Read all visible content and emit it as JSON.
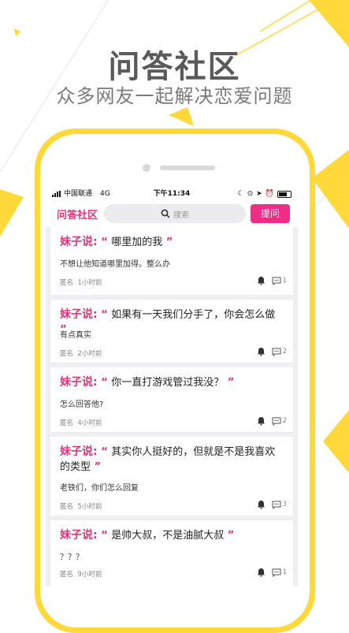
{
  "colors": {
    "accent": "#e6337a",
    "button": "#ee2e86",
    "frame": "#ffd93a"
  },
  "promo": {
    "title": "问答社区",
    "subtitle": "众多网友一起解决恋爱问题"
  },
  "status": {
    "carrier": "中国联通",
    "network": "4G",
    "time": "下午11:34"
  },
  "nav": {
    "title": "问答社区",
    "search_placeholder": "搜索",
    "ask_label": "提问"
  },
  "feed": [
    {
      "prefix": "妹子说:",
      "question": "哪里加的我",
      "answer": "不想让他知道哪里加得。整么办",
      "user": "匿名",
      "time": "1小时前",
      "comments": "1"
    },
    {
      "prefix": "妹子说:",
      "question": "如果有一天我们分手了，你会怎么做",
      "answer": "有点真实",
      "user": "匿名",
      "time": "2小时前",
      "comments": "2"
    },
    {
      "prefix": "妹子说:",
      "question": "你一直打游戏管过我没？",
      "answer": "怎么回答他?",
      "user": "匿名",
      "time": "4小时前",
      "comments": "2"
    },
    {
      "prefix": "妹子说:",
      "question": "其实你人挺好的，但就是不是我喜欢的类型",
      "answer": "老铁们，你们怎么回复",
      "user": "匿名",
      "time": "5小时前",
      "comments": "3"
    },
    {
      "prefix": "妹子说:",
      "question": "是帅大叔，不是油腻大叔",
      "answer": "？？？",
      "user": "匿名",
      "time": "9小时前",
      "comments": "1"
    }
  ],
  "icons": {
    "search": "search-icon",
    "bell": "bell-icon",
    "comment": "comment-icon"
  }
}
